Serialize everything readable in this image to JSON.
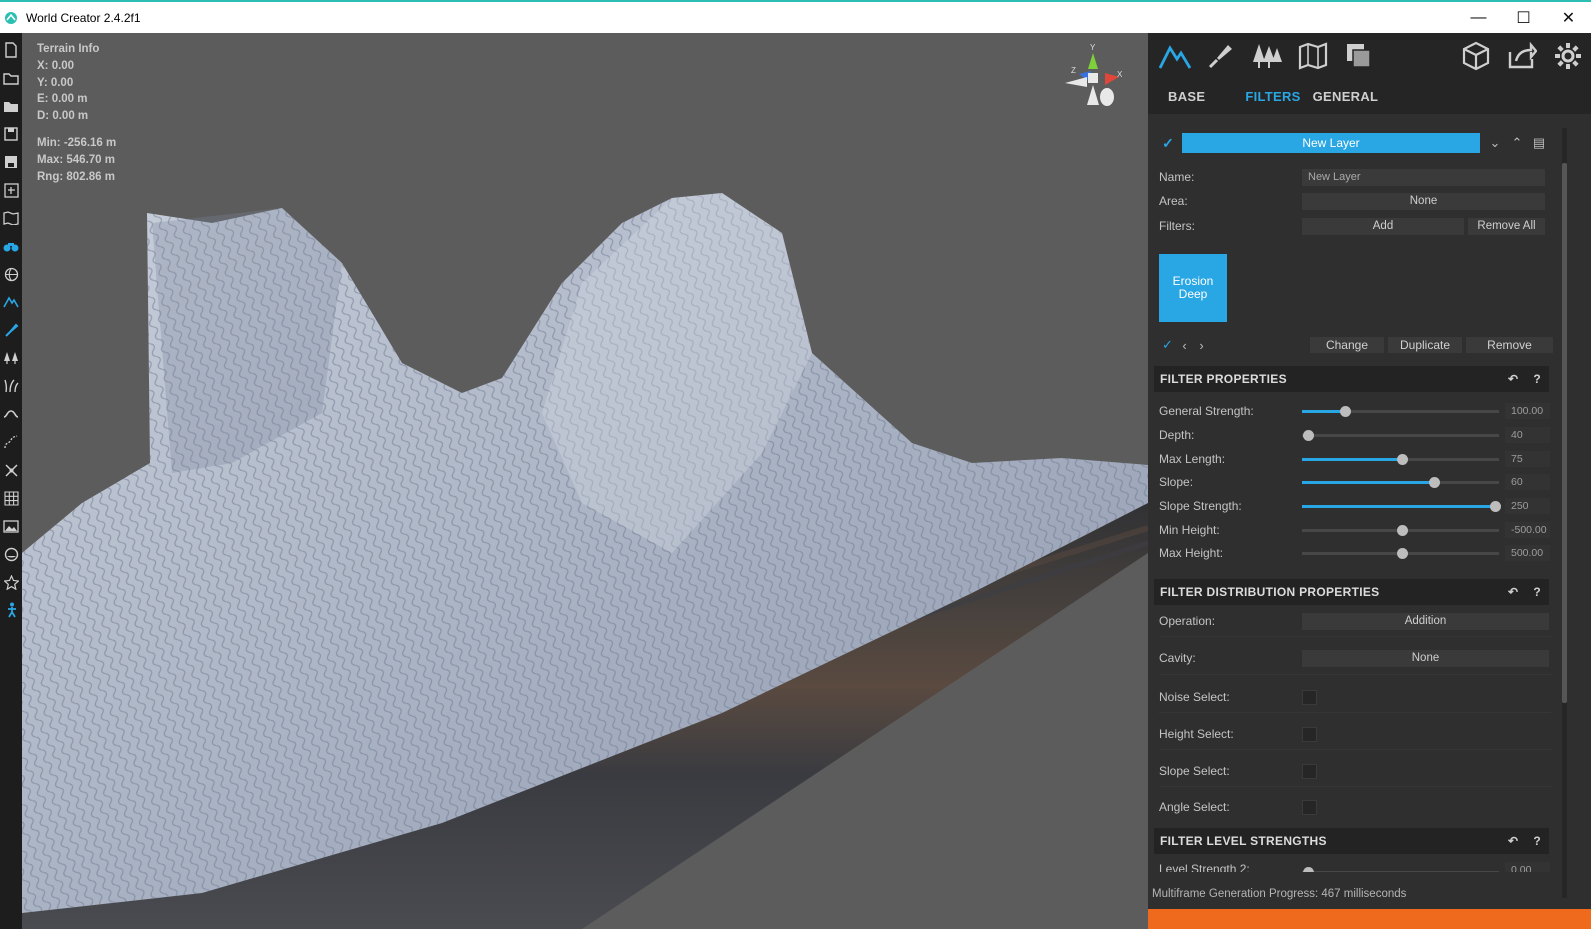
{
  "window": {
    "title": "World Creator 2.4.2f1",
    "minimize": "—",
    "maximize": "☐",
    "close": "✕"
  },
  "left_toolbar": [
    "new-file",
    "open-folder",
    "open-recent",
    "save",
    "save-as",
    "import",
    "map",
    "binoculars",
    "globe",
    "mountain",
    "brush",
    "trees",
    "grass",
    "river",
    "path",
    "transform",
    "grid",
    "image",
    "circle",
    "star",
    "figure"
  ],
  "terrain_info": {
    "title": "Terrain Info",
    "x": "X: 0.00",
    "y": "Y: 0.00",
    "e": "E: 0.00 m",
    "d": "D: 0.00 m",
    "min": "Min: -256.16 m",
    "max": "Max: 546.70 m",
    "rng": "Rng: 802.86 m"
  },
  "gizmo": {
    "y": "Y",
    "x": "X",
    "z": "Z"
  },
  "panel": {
    "top_icons": [
      "mountain-icon",
      "brush-icon",
      "trees-icon",
      "map-icon",
      "layers-icon",
      "cube-icon",
      "share-icon",
      "gear-icon"
    ],
    "tabs": {
      "base": "BASE",
      "filters": "FILTERS",
      "general": "GENERAL"
    },
    "layer": {
      "name_button": "New Layer",
      "check": "✓"
    },
    "name_label": "Name:",
    "name_value": "New Layer",
    "area_label": "Area:",
    "area_value": "None",
    "filters_label": "Filters:",
    "add_label": "Add",
    "remove_all_label": "Remove All",
    "filter_card": {
      "line1": "Erosion",
      "line2": "Deep"
    },
    "filter_nav": {
      "check": "✓",
      "prev": "‹",
      "next": "›",
      "change": "Change",
      "duplicate": "Duplicate",
      "remove": "Remove"
    },
    "filter_properties": {
      "title": "FILTER PROPERTIES",
      "sliders": [
        {
          "label": "General Strength:",
          "value": "100.00",
          "fraction": 0.22,
          "filled": true
        },
        {
          "label": "Depth:",
          "value": "40",
          "fraction": 0.03,
          "filled": false
        },
        {
          "label": "Max Length:",
          "value": "75",
          "fraction": 0.51,
          "filled": true
        },
        {
          "label": "Slope:",
          "value": "60",
          "fraction": 0.67,
          "filled": true
        },
        {
          "label": "Slope Strength:",
          "value": "250",
          "fraction": 0.98,
          "filled": true
        },
        {
          "label": "Min Height:",
          "value": "-500.00",
          "fraction": 0.51,
          "filled": false
        },
        {
          "label": "Max Height:",
          "value": "500.00",
          "fraction": 0.51,
          "filled": false
        }
      ]
    },
    "distribution": {
      "title": "FILTER DISTRIBUTION PROPERTIES",
      "operation_label": "Operation:",
      "operation_value": "Addition",
      "cavity_label": "Cavity:",
      "cavity_value": "None",
      "noise_label": "Noise Select:",
      "height_label": "Height Select:",
      "slope_label": "Slope Select:",
      "angle_label": "Angle Select:"
    },
    "level_strengths": {
      "title": "FILTER LEVEL STRENGTHS",
      "partial_label": "Level Strength 2:",
      "partial_value": "0.00"
    },
    "status": "Multiframe Generation Progress: 467 milliseconds",
    "progress_fraction": 1.0,
    "colors": {
      "accent": "#29a6e4",
      "progress": "#f06a1e"
    }
  }
}
